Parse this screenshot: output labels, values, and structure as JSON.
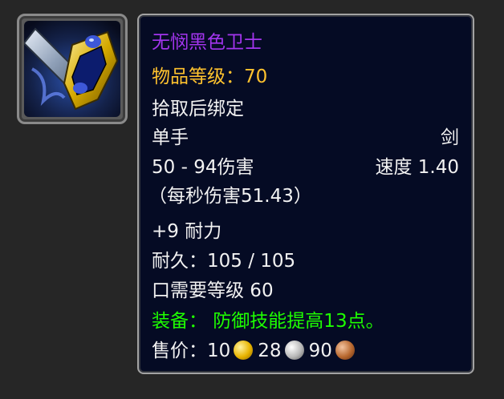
{
  "item": {
    "icon_name": "sword-icon",
    "name": "无悯黑色卫士",
    "item_level": "物品等级：70",
    "bind": "拾取后绑定",
    "slot": "单手",
    "type": "剑",
    "damage": "50 - 94伤害",
    "speed": "速度 1.40",
    "dps": "（每秒伤害51.43）",
    "stat": "+9 耐力",
    "durability": "耐久：105 / 105",
    "requirement": "口需要等级 60",
    "equip_effect": "装备： 防御技能提高13点。",
    "sell_label": "售价：",
    "sell_gold": "10",
    "sell_silver": "28",
    "sell_copper": "90"
  },
  "colors": {
    "name_epic": "#a335ee",
    "item_level": "#ffc22e",
    "equip_effect": "#1eff00",
    "tooltip_bg": "#050b24"
  }
}
